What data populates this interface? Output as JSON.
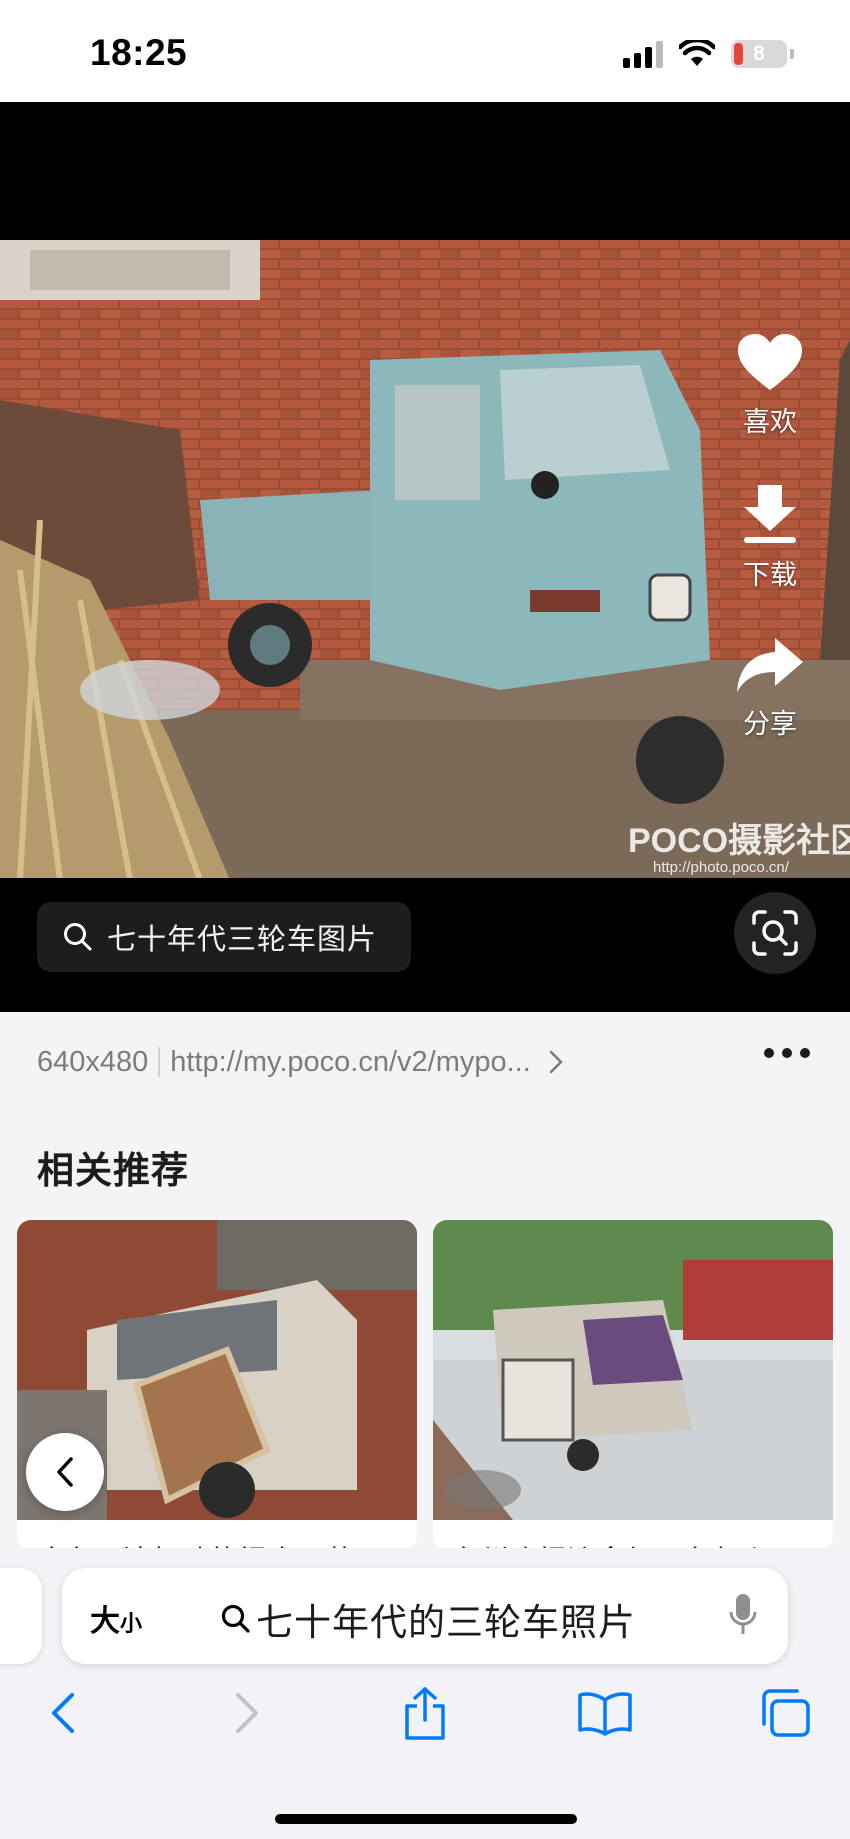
{
  "status_bar": {
    "time": "18:25",
    "battery": "8",
    "icons": [
      "signal-icon",
      "wifi-icon",
      "battery-icon"
    ]
  },
  "viewer": {
    "actions": [
      {
        "icon": "heart-icon",
        "label": "喜欢"
      },
      {
        "icon": "download-icon",
        "label": "下载"
      },
      {
        "icon": "share-icon",
        "label": "分享"
      }
    ],
    "watermark": "POCO摄影社区",
    "watermark_url": "http://photo.poco.cn/",
    "search_text": "七十年代三轮车图片",
    "lens_icon": "visual-search-icon"
  },
  "info": {
    "dimensions": "640x480",
    "source_url": "http://my.poco.cn/v2/mypo..."
  },
  "related": {
    "title": "相关推荐",
    "cards": [
      {
        "caption": "这台无法驾驶的报废面蓉"
      },
      {
        "caption": "台州晚报流拿便民车怎么"
      }
    ]
  },
  "safari": {
    "aa_big": "大",
    "aa_small": "小",
    "query": "七十年代的三轮车照片",
    "toolbar": [
      "back-icon",
      "forward-icon",
      "share-icon",
      "bookmarks-icon",
      "tabs-icon"
    ]
  },
  "colors": {
    "accent": "#007aff",
    "dark_bg": "#000000"
  }
}
